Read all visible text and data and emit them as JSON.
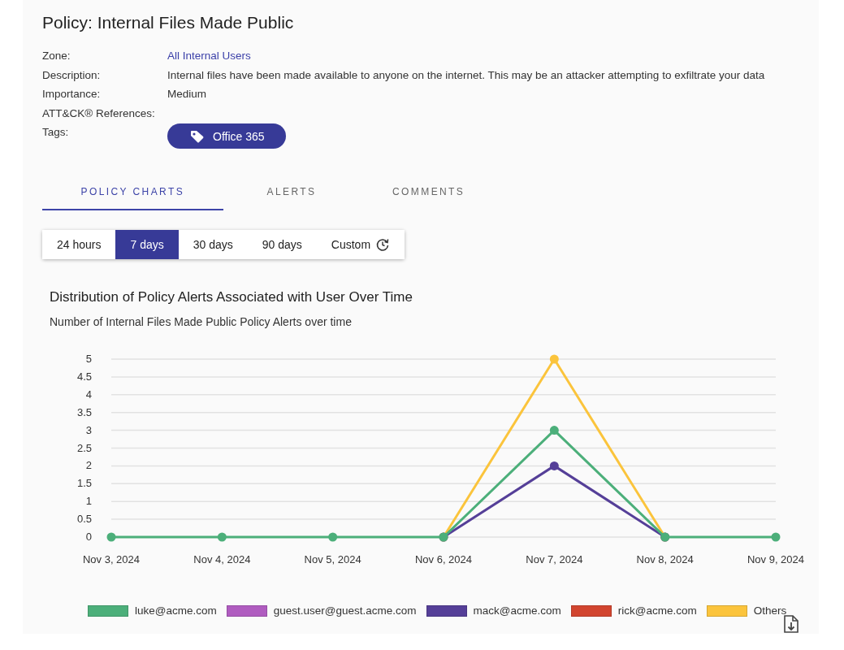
{
  "title": "Policy: Internal Files Made Public",
  "details": [
    {
      "label": "Zone:",
      "value": "All Internal Users",
      "kind": "link"
    },
    {
      "label": "Description:",
      "value": "Internal files have been made available to anyone on the internet. This may be an attacker attempting to exfiltrate your data",
      "kind": "text"
    },
    {
      "label": "Importance:",
      "value": "Medium",
      "kind": "text"
    },
    {
      "label": "ATT&CK® References:",
      "kind": "empty"
    },
    {
      "label": "Tags:",
      "tags": [
        "Office 365"
      ],
      "kind": "tags"
    }
  ],
  "tabs": [
    {
      "label": "POLICY CHARTS",
      "selected": true
    },
    {
      "label": "ALERTS",
      "selected": false
    },
    {
      "label": "COMMENTS",
      "selected": false
    }
  ],
  "ranges": [
    {
      "label": "24 hours",
      "selected": false
    },
    {
      "label": "7 days",
      "selected": true
    },
    {
      "label": "30 days",
      "selected": false
    },
    {
      "label": "90 days",
      "selected": false
    },
    {
      "label": "Custom",
      "selected": false,
      "kind": "custom"
    }
  ],
  "chart_title": "Distribution of Policy Alerts Associated with User Over Time",
  "chart_subtitle": "Number of Internal Files Made Public Policy Alerts over time",
  "chart_data": {
    "type": "line",
    "grid": true,
    "categories": [
      "Nov 3, 2024",
      "Nov 4, 2024",
      "Nov 5, 2024",
      "Nov 6, 2024",
      "Nov 7, 2024",
      "Nov 8, 2024",
      "Nov 9, 2024"
    ],
    "ylim": [
      0,
      5
    ],
    "yticks": [
      0,
      0.5,
      1,
      1.5,
      2,
      2.5,
      3,
      3.5,
      4,
      4.5,
      5
    ],
    "series": [
      {
        "name": "luke@acme.com",
        "color": "#4caf7a",
        "marker": true,
        "values": [
          0,
          0,
          0,
          0,
          3,
          0,
          0
        ]
      },
      {
        "name": "guest.user@guest.acme.com",
        "color": "#b05cc0",
        "values": [
          null,
          null,
          null,
          null,
          null,
          null,
          null
        ]
      },
      {
        "name": "mack@acme.com",
        "color": "#553f98",
        "marker": true,
        "values": [
          null,
          null,
          null,
          0,
          2,
          0,
          null
        ]
      },
      {
        "name": "rick@acme.com",
        "color": "#d2452f",
        "values": [
          null,
          null,
          null,
          null,
          null,
          null,
          null
        ]
      },
      {
        "name": "Others",
        "color": "#fbc43c",
        "marker": true,
        "values": [
          null,
          null,
          null,
          0,
          5,
          0,
          null
        ]
      }
    ]
  }
}
